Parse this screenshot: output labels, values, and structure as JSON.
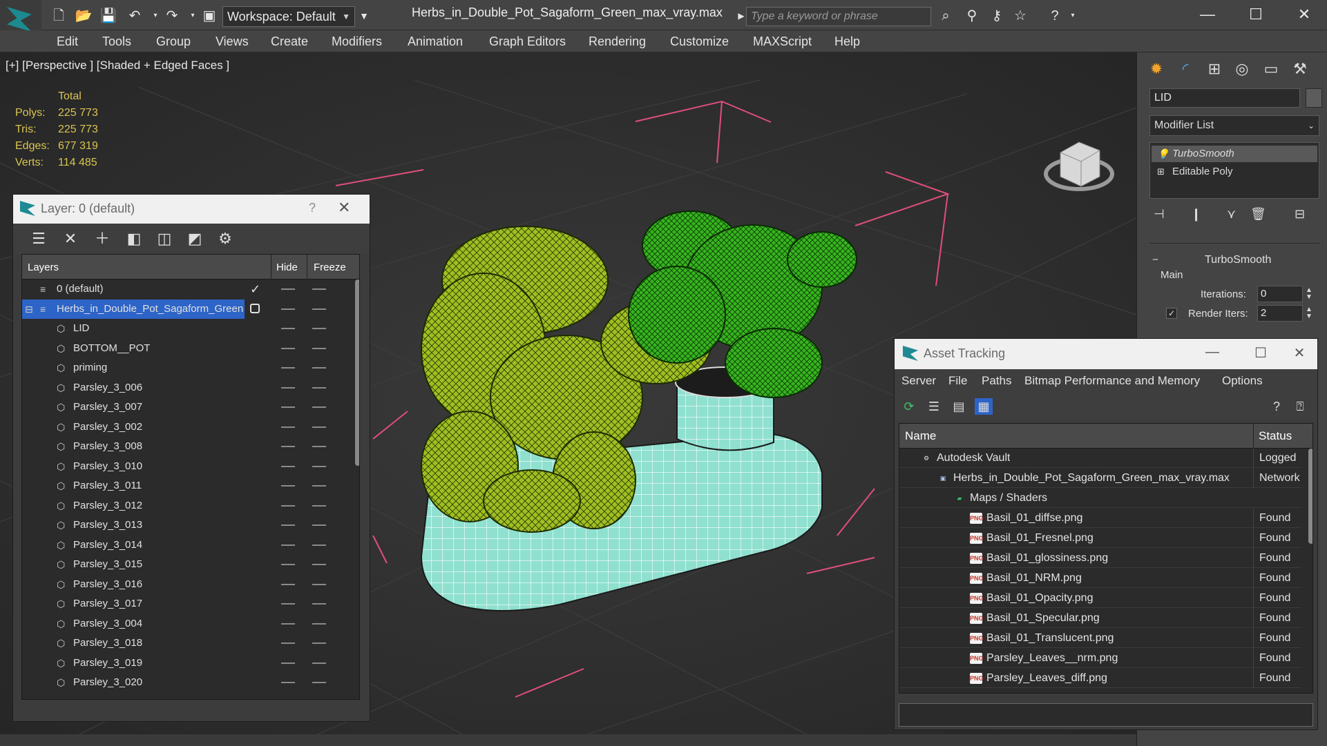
{
  "titlebar": {
    "workspace_label": "Workspace: Default",
    "document_title": "Herbs_in_Double_Pot_Sagaform_Green_max_vray.max",
    "search_placeholder": "Type a keyword or phrase"
  },
  "menubar": {
    "items": [
      "Edit",
      "Tools",
      "Group",
      "Views",
      "Create",
      "Modifiers",
      "Animation",
      "Graph Editors",
      "Rendering",
      "Customize",
      "MAXScript",
      "Help"
    ]
  },
  "viewport": {
    "label": "[+] [Perspective ] [Shaded + Edged Faces ]",
    "stats": {
      "header": "Total",
      "rows": [
        {
          "key": "Polys:",
          "value": "225 773"
        },
        {
          "key": "Tris:",
          "value": "225 773"
        },
        {
          "key": "Edges:",
          "value": "677 319"
        },
        {
          "key": "Verts:",
          "value": "114 485"
        }
      ]
    }
  },
  "layer_panel": {
    "title": "Layer: 0 (default)",
    "help": "?",
    "columns": {
      "layers": "Layers",
      "hide": "Hide",
      "freeze": "Freeze"
    },
    "rows": [
      {
        "name": "0 (default)",
        "indent": 0
      },
      {
        "name": "Herbs_in_Double_Pot_Sagaform_Green",
        "indent": 0
      },
      {
        "name": "LID",
        "indent": 1
      },
      {
        "name": "BOTTOM__POT",
        "indent": 1
      },
      {
        "name": "priming",
        "indent": 1
      },
      {
        "name": "Parsley_3_006",
        "indent": 1
      },
      {
        "name": "Parsley_3_007",
        "indent": 1
      },
      {
        "name": "Parsley_3_002",
        "indent": 1
      },
      {
        "name": "Parsley_3_008",
        "indent": 1
      },
      {
        "name": "Parsley_3_010",
        "indent": 1
      },
      {
        "name": "Parsley_3_011",
        "indent": 1
      },
      {
        "name": "Parsley_3_012",
        "indent": 1
      },
      {
        "name": "Parsley_3_013",
        "indent": 1
      },
      {
        "name": "Parsley_3_014",
        "indent": 1
      },
      {
        "name": "Parsley_3_015",
        "indent": 1
      },
      {
        "name": "Parsley_3_016",
        "indent": 1
      },
      {
        "name": "Parsley_3_017",
        "indent": 1
      },
      {
        "name": "Parsley_3_004",
        "indent": 1
      },
      {
        "name": "Parsley_3_018",
        "indent": 1
      },
      {
        "name": "Parsley_3_019",
        "indent": 1
      },
      {
        "name": "Parsley_3_020",
        "indent": 1
      }
    ]
  },
  "command_panel": {
    "object_name": "LID",
    "modifier_list": "Modifier List",
    "stack": [
      "TurboSmooth",
      "Editable Poly"
    ],
    "rollout_title": "TurboSmooth",
    "group_main": "Main",
    "iterations_label": "Iterations:",
    "iterations_value": "0",
    "render_iters_label": "Render Iters:",
    "render_iters_value": "2"
  },
  "asset_tracking": {
    "title": "Asset Tracking",
    "menu": [
      "Server",
      "File",
      "Paths",
      "Bitmap Performance and Memory",
      "Options"
    ],
    "columns": {
      "name": "Name",
      "status": "Status"
    },
    "rows": [
      {
        "name": "Autodesk Vault",
        "status": "Logged",
        "indent": 0,
        "icon": "vault"
      },
      {
        "name": "Herbs_in_Double_Pot_Sagaform_Green_max_vray.max",
        "status": "Network",
        "indent": 1,
        "icon": "max"
      },
      {
        "name": "Maps / Shaders",
        "status": "",
        "indent": 2,
        "icon": "maps"
      },
      {
        "name": "Basil_01_diffse.png",
        "status": "Found",
        "indent": 3,
        "icon": "png"
      },
      {
        "name": "Basil_01_Fresnel.png",
        "status": "Found",
        "indent": 3,
        "icon": "png"
      },
      {
        "name": "Basil_01_glossiness.png",
        "status": "Found",
        "indent": 3,
        "icon": "png"
      },
      {
        "name": "Basil_01_NRM.png",
        "status": "Found",
        "indent": 3,
        "icon": "png"
      },
      {
        "name": "Basil_01_Opacity.png",
        "status": "Found",
        "indent": 3,
        "icon": "png"
      },
      {
        "name": "Basil_01_Specular.png",
        "status": "Found",
        "indent": 3,
        "icon": "png"
      },
      {
        "name": "Basil_01_Translucent.png",
        "status": "Found",
        "indent": 3,
        "icon": "png"
      },
      {
        "name": "Parsley_Leaves__nrm.png",
        "status": "Found",
        "indent": 3,
        "icon": "png"
      },
      {
        "name": "Parsley_Leaves_diff.png",
        "status": "Found",
        "indent": 3,
        "icon": "png"
      }
    ]
  },
  "colors": {
    "stats_text": "#d9c552",
    "selection": "#2d64c8",
    "accent_teal": "#1f8a93",
    "pot_wire": "#8fe0cf",
    "basil_green": "#9fbf22",
    "parsley_green": "#37b51f"
  }
}
